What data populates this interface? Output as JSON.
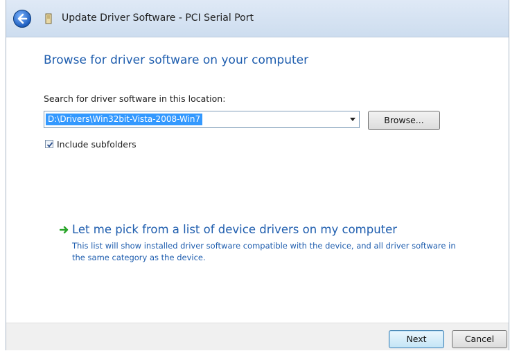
{
  "window": {
    "title": "Update Driver Software - PCI Serial Port"
  },
  "page": {
    "heading": "Browse for driver software on your computer",
    "search_label": "Search for driver software in this location:",
    "location_value": "D:\\Drivers\\Win32bit-Vista-2008-Win7",
    "browse_label": "Browse...",
    "include_subfolders_label": "Include subfolders",
    "include_subfolders_checked": true,
    "pick_title": "Let me pick from a list of device drivers on my computer",
    "pick_description": "This list will show installed driver software compatible with the device, and all driver software in the same category as the device."
  },
  "footer": {
    "next_label": "Next",
    "cancel_label": "Cancel"
  },
  "colors": {
    "heading_blue": "#1e5dae",
    "selection_blue": "#3399ff",
    "arrow_green": "#2aa52a"
  }
}
